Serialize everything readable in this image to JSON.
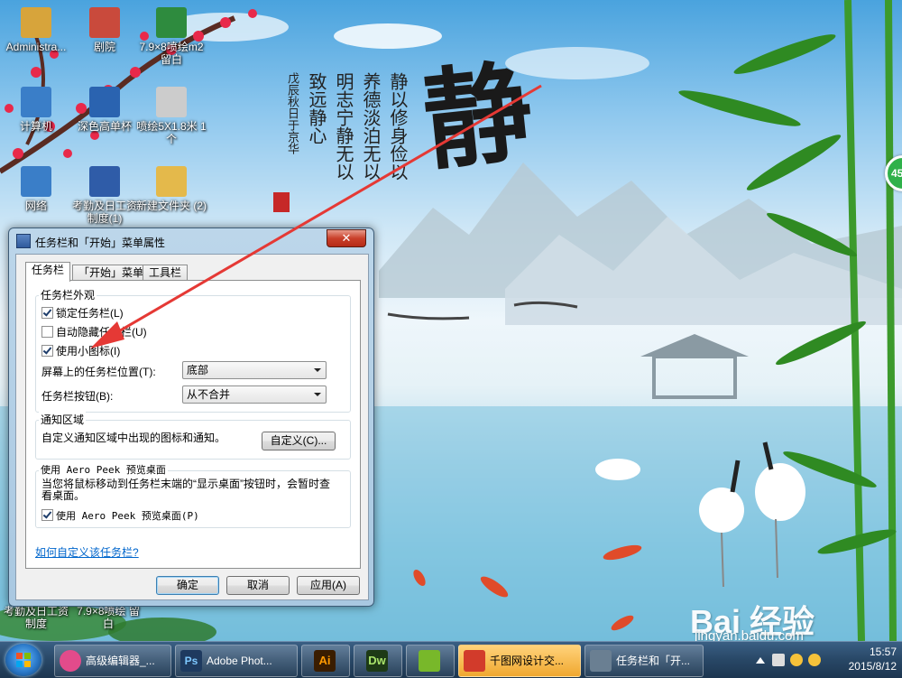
{
  "desktop_icons": [
    {
      "label": "Administra...",
      "icon": "user-folder-icon",
      "color": "#d7a43b"
    },
    {
      "label": "剧院",
      "icon": "photo-icon",
      "color": "#c94a3c"
    },
    {
      "label": "7.9×8喷绘m2 留白",
      "icon": "excel-file-icon",
      "color": "#2e8b3e"
    },
    {
      "label": "计算机",
      "icon": "computer-icon",
      "color": "#3a7ec8"
    },
    {
      "label": "深色高单杯",
      "icon": "psd-file-icon",
      "color": "#2a63b0"
    },
    {
      "label": "喷绘5X1.8米 1个",
      "icon": "image-file-icon",
      "color": "#cccccc"
    },
    {
      "label": "网络",
      "icon": "network-icon",
      "color": "#3a7ec8"
    },
    {
      "label": "考勤及日工资制度(1)",
      "icon": "word-file-icon",
      "color": "#2f5ca8"
    },
    {
      "label": "新建文件夹 (2)",
      "icon": "folder-icon",
      "color": "#e4b94b"
    }
  ],
  "bottom_icons": [
    {
      "label": "考勤及日工资制度"
    },
    {
      "label": "7.9×8喷绘 留白"
    }
  ],
  "wallpaper": {
    "big_char": "静",
    "poem_lines": [
      "静以修身俭以",
      "养德淡泊无以",
      "明志宁静无以",
      "致远静心"
    ],
    "signature": "戊辰秋日于京华"
  },
  "notification_badge": "45",
  "dialog": {
    "title": "任务栏和「开始」菜单属性",
    "close_label": "✕",
    "tabs": [
      "任务栏",
      "「开始」菜单",
      "工具栏"
    ],
    "group_appearance": {
      "label": "任务栏外观",
      "lock_taskbar": {
        "label": "锁定任务栏(L)",
        "checked": true
      },
      "auto_hide": {
        "label": "自动隐藏任务栏(U)",
        "checked": false
      },
      "small_icons": {
        "label": "使用小图标(I)",
        "checked": true
      },
      "location_label": "屏幕上的任务栏位置(T):",
      "location_value": "底部",
      "buttons_label": "任务栏按钮(B):",
      "buttons_value": "从不合并"
    },
    "group_notify": {
      "label": "通知区域",
      "text": "自定义通知区域中出现的图标和通知。",
      "customize_button": "自定义(C)..."
    },
    "group_aero": {
      "label": "使用 Aero Peek 预览桌面",
      "text": "当您将鼠标移动到任务栏末端的“显示桌面”按钮时，会暂时查看桌面。",
      "checkbox": {
        "label": "使用 Aero Peek 预览桌面(P)",
        "checked": true
      }
    },
    "help_link": "如何自定义该任务栏?",
    "ok_button": "确定",
    "cancel_button": "取消",
    "apply_button": "应用(A)"
  },
  "taskbar": {
    "items": [
      {
        "label": "高级编辑器_...",
        "icon": "editor-app-icon",
        "color": "#e24b8b"
      },
      {
        "label": "Adobe Phot...",
        "icon": "photoshop-icon",
        "color": "#1e3a5f"
      },
      {
        "label": "Ai",
        "icon": "illustrator-icon",
        "color": "#3a1d00"
      },
      {
        "label": "Dw",
        "icon": "dreamweaver-icon",
        "color": "#1d3a16"
      },
      {
        "label": "",
        "icon": "app-icon",
        "color": "#78b82a"
      },
      {
        "label": "千图网设计交...",
        "icon": "qiantu-icon",
        "color": "#d23b2b"
      },
      {
        "label": "任务栏和「开...",
        "icon": "taskbar-props-icon",
        "color": "#6a7f92"
      }
    ],
    "clock_time": "15:57",
    "clock_date": "2015/8/12"
  },
  "watermark": {
    "logo": "Bai 经验",
    "url": "jingyan.baidu.com"
  },
  "colors": {
    "arrow": "#e53935",
    "link": "#0066cc"
  }
}
